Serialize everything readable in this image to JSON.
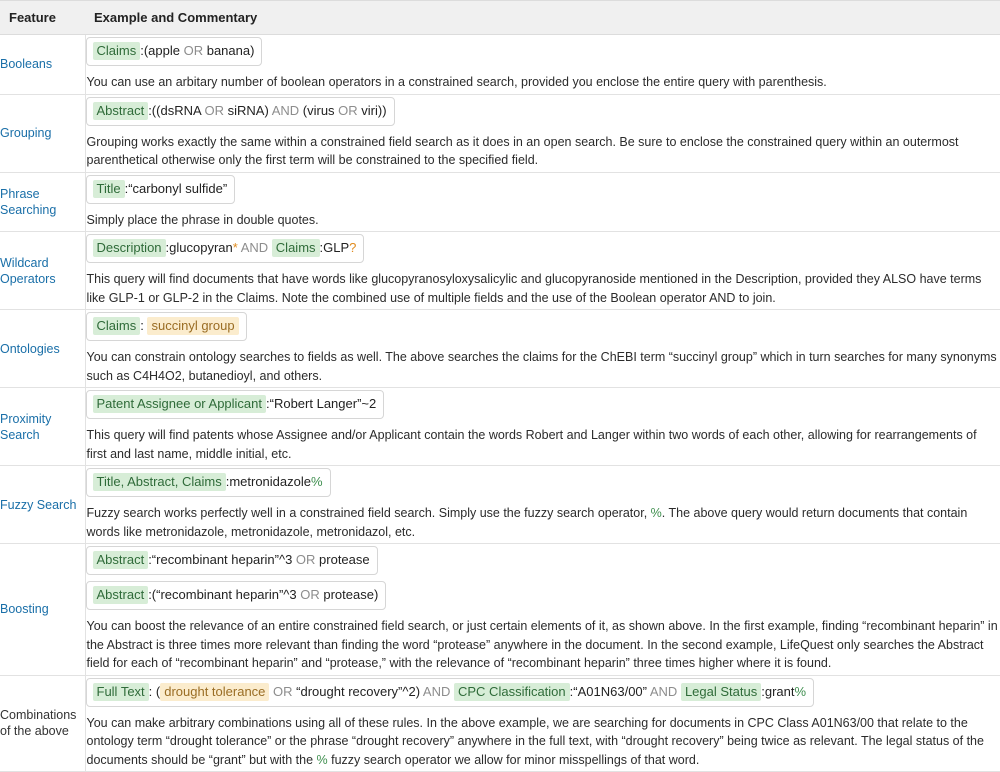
{
  "table": {
    "headers": {
      "feature": "Feature",
      "example": "Example and Commentary"
    },
    "rows": [
      {
        "feature": "Booleans",
        "feature_style": "link",
        "queries": [
          {
            "tokens": [
              {
                "type": "field",
                "text": "Claims"
              },
              {
                "type": "plain",
                "text": ":(apple "
              },
              {
                "type": "op",
                "text": "OR"
              },
              {
                "type": "plain",
                "text": " banana)"
              }
            ]
          }
        ],
        "commentary": "You can use an arbitary number of boolean operators in a constrained search, provided you enclose the entire query with parenthesis."
      },
      {
        "feature": "Grouping",
        "feature_style": "link",
        "queries": [
          {
            "tokens": [
              {
                "type": "field",
                "text": "Abstract"
              },
              {
                "type": "plain",
                "text": ":((dsRNA "
              },
              {
                "type": "op",
                "text": "OR"
              },
              {
                "type": "plain",
                "text": " siRNA) "
              },
              {
                "type": "op",
                "text": "AND"
              },
              {
                "type": "plain",
                "text": " (virus "
              },
              {
                "type": "op",
                "text": "OR"
              },
              {
                "type": "plain",
                "text": " viri))"
              }
            ]
          }
        ],
        "commentary": "Grouping works exactly the same within a constrained field search as it does in an open search. Be sure to enclose the constrained query within an outermost parenthetical otherwise only the first term will be constrained to the specified field."
      },
      {
        "feature": "Phrase Searching",
        "feature_style": "link",
        "queries": [
          {
            "tokens": [
              {
                "type": "field",
                "text": "Title"
              },
              {
                "type": "plain",
                "text": ":“carbonyl sulfide”"
              }
            ]
          }
        ],
        "commentary": "Simply place the phrase in double quotes."
      },
      {
        "feature": "Wildcard Operators",
        "feature_style": "link",
        "queries": [
          {
            "tokens": [
              {
                "type": "field",
                "text": "Description"
              },
              {
                "type": "plain",
                "text": ":glucopyran"
              },
              {
                "type": "wild",
                "text": "*"
              },
              {
                "type": "plain",
                "text": " "
              },
              {
                "type": "op",
                "text": "AND"
              },
              {
                "type": "plain",
                "text": " "
              },
              {
                "type": "field",
                "text": "Claims"
              },
              {
                "type": "plain",
                "text": ":GLP"
              },
              {
                "type": "wild",
                "text": "?"
              }
            ]
          }
        ],
        "commentary": "This query will find documents that have words like glucopyranosyloxysalicylic and glucopyranoside mentioned in the Description, provided they ALSO have terms like GLP-1 or GLP-2 in the Claims. Note the combined use of multiple fields and the use of the Boolean operator AND to join."
      },
      {
        "feature": "Ontologies",
        "feature_style": "link",
        "queries": [
          {
            "tokens": [
              {
                "type": "field",
                "text": "Claims"
              },
              {
                "type": "plain",
                "text": ": "
              },
              {
                "type": "onto",
                "text": "succinyl group"
              }
            ]
          }
        ],
        "commentary": "You can constrain ontology searches to fields as well. The above searches the claims for the ChEBI term “succinyl group” which in turn searches for many synonyms such as C4H4O2, butanedioyl, and others."
      },
      {
        "feature": "Proximity Search",
        "feature_style": "link",
        "queries": [
          {
            "tokens": [
              {
                "type": "field",
                "text": "Patent Assignee or Applicant"
              },
              {
                "type": "plain",
                "text": ":“Robert Langer”~2"
              }
            ]
          }
        ],
        "commentary": "This query will find patents whose Assignee and/or Applicant contain the words Robert and Langer within two words of each other, allowing for rearrangements of first and last name, middle initial, etc."
      },
      {
        "feature": "Fuzzy Search",
        "feature_style": "link",
        "queries": [
          {
            "tokens": [
              {
                "type": "field",
                "text": "Title, Abstract, Claims"
              },
              {
                "type": "plain",
                "text": ":metronidazole"
              },
              {
                "type": "pct",
                "text": "%"
              }
            ]
          }
        ],
        "commentary_parts": [
          {
            "type": "plain",
            "text": "Fuzzy search works perfectly well in a constrained field search. Simply use the fuzzy search operator, "
          },
          {
            "type": "pct",
            "text": "%"
          },
          {
            "type": "plain",
            "text": ". The above query would return documents that contain words like metronidazole, metronidazole, metronidazol, etc."
          }
        ]
      },
      {
        "feature": "Boosting",
        "feature_style": "link",
        "queries": [
          {
            "tokens": [
              {
                "type": "field",
                "text": "Abstract"
              },
              {
                "type": "plain",
                "text": ":“recombinant heparin”^3 "
              },
              {
                "type": "op",
                "text": "OR"
              },
              {
                "type": "plain",
                "text": " protease"
              }
            ]
          },
          {
            "tokens": [
              {
                "type": "field",
                "text": "Abstract"
              },
              {
                "type": "plain",
                "text": ":(“recombinant heparin”^3 "
              },
              {
                "type": "op",
                "text": "OR"
              },
              {
                "type": "plain",
                "text": " protease)"
              }
            ]
          }
        ],
        "commentary": "You can boost the relevance of an entire constrained field search, or just certain elements of it, as shown above. In the first example, finding “recombinant heparin” in the Abstract is three times more relevant than finding the word “protease” anywhere in the document. In the second example, LifeQuest only searches the Abstract field for each of “recombinant heparin” and “protease,” with the relevance of “recombinant heparin” three times higher where it is found."
      },
      {
        "feature": "Combinations of the above",
        "feature_style": "plain",
        "queries": [
          {
            "tokens": [
              {
                "type": "field",
                "text": "Full Text"
              },
              {
                "type": "plain",
                "text": ": ("
              },
              {
                "type": "onto",
                "text": "drought tolerance"
              },
              {
                "type": "plain",
                "text": " "
              },
              {
                "type": "op",
                "text": "OR"
              },
              {
                "type": "plain",
                "text": " “drought recovery”^2) "
              },
              {
                "type": "op",
                "text": "AND"
              },
              {
                "type": "plain",
                "text": " "
              },
              {
                "type": "field",
                "text": "CPC Classification"
              },
              {
                "type": "plain",
                "text": ":“A01N63/00” "
              },
              {
                "type": "op",
                "text": "AND"
              },
              {
                "type": "plain",
                "text": " "
              },
              {
                "type": "field",
                "text": "Legal Status"
              },
              {
                "type": "plain",
                "text": ":grant"
              },
              {
                "type": "pct",
                "text": "%"
              }
            ]
          }
        ],
        "commentary_parts": [
          {
            "type": "plain",
            "text": "You can make arbitrary combinations using all of these rules. In the above example, we are searching for documents in CPC Class A01N63/00 that relate to the ontology term “drought tolerance” or the phrase “drought recovery” anywhere in the full text, with “drought recovery” being twice as relevant. The legal status of the documents should be “grant” but with the "
          },
          {
            "type": "pct",
            "text": "%"
          },
          {
            "type": "plain",
            "text": " fuzzy search operator we allow for minor misspellings of that word."
          }
        ]
      }
    ]
  },
  "colors": {
    "header_bg": "#f0f0f0",
    "field_chip_bg": "#d7edd7",
    "field_chip_text": "#2f6b39",
    "ontology_chip_bg": "#fbeccd",
    "ontology_chip_text": "#9a6d24",
    "operator_text": "#8d8d8d",
    "wildcard_text": "#e08b1e",
    "feature_link": "#1a6fa8",
    "percent_green": "#3f8f4f",
    "border": "#e2e2e2"
  }
}
